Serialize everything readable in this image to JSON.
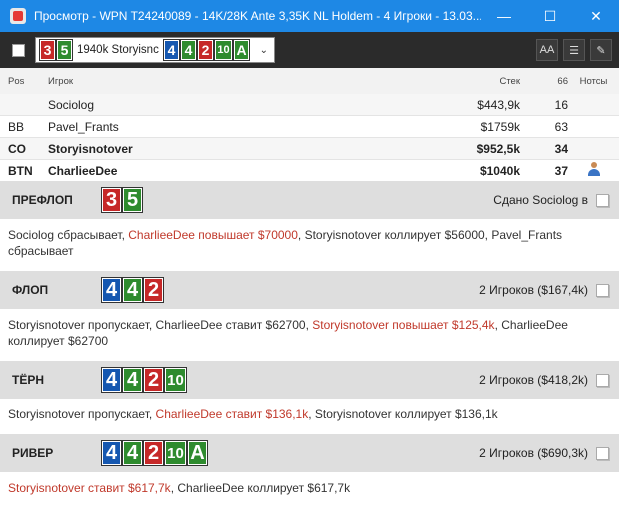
{
  "window": {
    "title": "Просмотр - WPN T24240089 - 14K/28K Ante 3,35K NL Holdem - 4 Игроки - 13.03...",
    "minimize_glyph": "—",
    "maximize_glyph": "☐",
    "close_glyph": "✕"
  },
  "toolbar": {
    "hand_selector_text": "1940k Storyisnc",
    "font_button": "AA",
    "list_button": "☰",
    "edit_button": "✎"
  },
  "hand_selector_cards": [
    {
      "rank": "3",
      "color": "red"
    },
    {
      "rank": "5",
      "color": "green"
    },
    {
      "rank": "4",
      "color": "blue"
    },
    {
      "rank": "4",
      "color": "green"
    },
    {
      "rank": "2",
      "color": "red"
    },
    {
      "rank": "10",
      "color": "green"
    },
    {
      "rank": "A",
      "color": "green"
    }
  ],
  "players_table": {
    "headers": {
      "pos": "Pos",
      "player": "Игрок",
      "stack": "Стек",
      "col66": "66",
      "notes": "Нотсы"
    },
    "rows": [
      {
        "pos": "",
        "player": "Sociolog",
        "stack": "$443,9k",
        "col66": "16",
        "bold": false
      },
      {
        "pos": "BB",
        "player": "Pavel_Frants",
        "stack": "$1759k",
        "col66": "63",
        "bold": false
      },
      {
        "pos": "CO",
        "player": "Storyisnotover",
        "stack": "$952,5k",
        "col66": "34",
        "bold": true
      },
      {
        "pos": "BTN",
        "player": "CharlieeDee",
        "stack": "$1040k",
        "col66": "37",
        "bold": true
      }
    ]
  },
  "streets": {
    "preflop": {
      "name": "ПРЕФЛОП",
      "cards": [
        {
          "rank": "3",
          "color": "red"
        },
        {
          "rank": "5",
          "color": "green"
        }
      ],
      "info": "Сдано Sociolog в",
      "actions": [
        {
          "text": "Sociolog сбрасывает, ",
          "highlight": false
        },
        {
          "text": "CharlieeDee повышает $70000",
          "highlight": true
        },
        {
          "text": ", Storyisnotover коллирует $56000, Pavel_Frants сбрасывает",
          "highlight": false
        }
      ]
    },
    "flop": {
      "name": "ФЛОП",
      "cards": [
        {
          "rank": "4",
          "color": "blue"
        },
        {
          "rank": "4",
          "color": "green"
        },
        {
          "rank": "2",
          "color": "red"
        }
      ],
      "info": "2 Игроков ($167,4k)",
      "actions": [
        {
          "text": "Storyisnotover пропускает, CharlieeDee ставит $62700, ",
          "highlight": false
        },
        {
          "text": "Storyisnotover повышает $125,4k",
          "highlight": true
        },
        {
          "text": ", CharlieeDee коллирует $62700",
          "highlight": false
        }
      ]
    },
    "turn": {
      "name": "ТЁРН",
      "cards": [
        {
          "rank": "4",
          "color": "blue"
        },
        {
          "rank": "4",
          "color": "green"
        },
        {
          "rank": "2",
          "color": "red"
        },
        {
          "rank": "10",
          "color": "green"
        }
      ],
      "info": "2 Игроков ($418,2k)",
      "actions": [
        {
          "text": "Storyisnotover пропускает, ",
          "highlight": false
        },
        {
          "text": "CharlieeDee ставит $136,1k",
          "highlight": true
        },
        {
          "text": ", Storyisnotover коллирует $136,1k",
          "highlight": false
        }
      ]
    },
    "river": {
      "name": "РИВЕР",
      "cards": [
        {
          "rank": "4",
          "color": "blue"
        },
        {
          "rank": "4",
          "color": "green"
        },
        {
          "rank": "2",
          "color": "red"
        },
        {
          "rank": "10",
          "color": "green"
        },
        {
          "rank": "A",
          "color": "green"
        }
      ],
      "info": "2 Игроков ($690,3k)",
      "actions": [
        {
          "text": "Storyisnotover ставит $617,7k",
          "highlight": true
        },
        {
          "text": ", CharlieeDee коллирует $617,7k",
          "highlight": false
        }
      ]
    }
  },
  "colors": {
    "titlebar": "#1e88e5",
    "toolbar": "#2b2b2b",
    "card_red": "#c62828",
    "card_green": "#2e8b2e",
    "card_blue": "#1557b0",
    "highlight_text": "#c0392b"
  }
}
